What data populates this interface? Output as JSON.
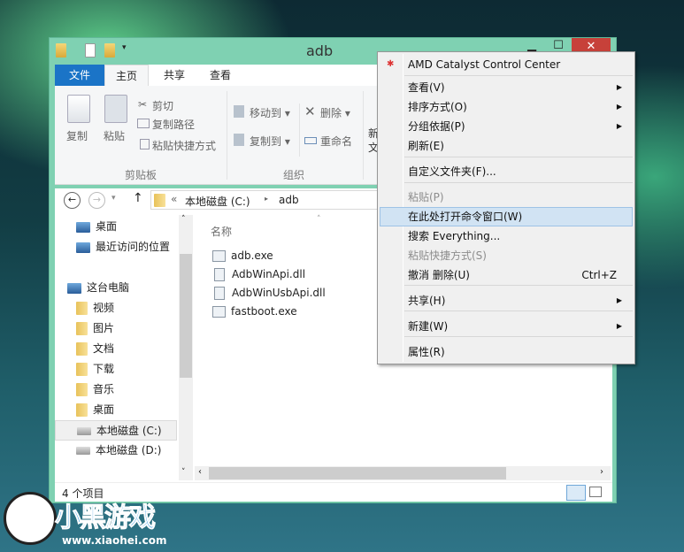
{
  "window": {
    "title": "adb",
    "minimize": "▁",
    "maximize": "☐",
    "close": "✕"
  },
  "ribbon": {
    "tabs": [
      "文件",
      "主页",
      "共享",
      "查看"
    ],
    "clipboard": {
      "copy": "复制",
      "paste": "粘贴",
      "cut": "剪切",
      "copy_path": "复制路径",
      "paste_shortcut": "粘贴快捷方式",
      "label": "剪贴板"
    },
    "organize": {
      "move_to": "移动到",
      "copy_to": "复制到",
      "delete": "删除",
      "rename": "重命名",
      "label": "组织"
    },
    "new_partial": "新\n文"
  },
  "address": {
    "chevrons": "«",
    "segments": [
      "本地磁盘 (C:)",
      "adb"
    ]
  },
  "nav": {
    "items": [
      {
        "label": "桌面",
        "icon": "desktop-icon"
      },
      {
        "label": "最近访问的位置",
        "icon": "recent-icon"
      },
      {
        "label": "这台电脑",
        "icon": "computer-icon"
      },
      {
        "label": "视频",
        "icon": "folder-icon"
      },
      {
        "label": "图片",
        "icon": "folder-icon"
      },
      {
        "label": "文档",
        "icon": "folder-icon"
      },
      {
        "label": "下载",
        "icon": "folder-icon"
      },
      {
        "label": "音乐",
        "icon": "folder-icon"
      },
      {
        "label": "桌面",
        "icon": "folder-icon"
      },
      {
        "label": "本地磁盘 (C:)",
        "icon": "drive-icon",
        "selected": true
      },
      {
        "label": "本地磁盘 (D:)",
        "icon": "drive-icon"
      }
    ]
  },
  "files": {
    "column": "名称",
    "items": [
      "adb.exe",
      "AdbWinApi.dll",
      "AdbWinUsbApi.dll",
      "fastboot.exe"
    ]
  },
  "status": {
    "count": "4 个项目"
  },
  "context_menu": {
    "items": [
      {
        "label": "AMD Catalyst Control Center"
      },
      {
        "label": "查看(V)",
        "submenu": true
      },
      {
        "label": "排序方式(O)",
        "submenu": true
      },
      {
        "label": "分组依据(P)",
        "submenu": true
      },
      {
        "label": "刷新(E)"
      },
      {
        "label": "自定义文件夹(F)..."
      },
      {
        "label": "粘贴(P)",
        "disabled": true
      },
      {
        "label": "在此处打开命令窗口(W)",
        "highlighted": true
      },
      {
        "label": "搜索 Everything..."
      },
      {
        "label": "粘贴快捷方式(S)",
        "disabled": true
      },
      {
        "label": "撤消 删除(U)",
        "shortcut": "Ctrl+Z"
      },
      {
        "label": "共享(H)",
        "submenu": true
      },
      {
        "label": "新建(W)",
        "submenu": true
      },
      {
        "label": "属性(R)"
      }
    ]
  },
  "watermark": {
    "text": "小黑游戏",
    "url": "www.xiaohei.com"
  },
  "colors": {
    "titlebar": "#7fd1b2",
    "file_tab": "#1b74c7",
    "close": "#c7413a",
    "highlight": "#d1e3f3"
  }
}
